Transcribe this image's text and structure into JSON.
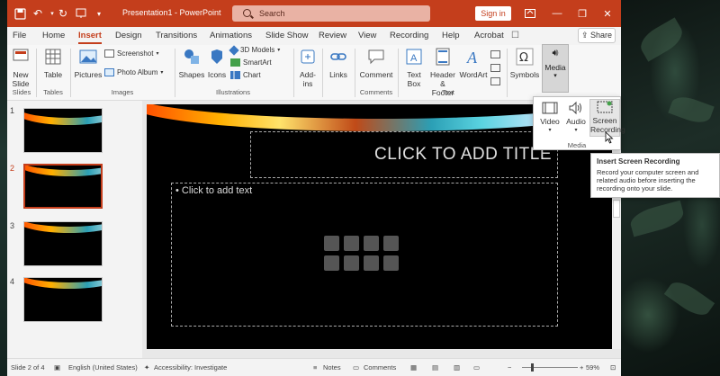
{
  "titlebar": {
    "title": "Presentation1  -  PowerPoint",
    "search_placeholder": "Search",
    "signin_label": "Sign in",
    "minimize": "—",
    "restore": "❐",
    "close": "✕"
  },
  "tabs": [
    {
      "label": "File"
    },
    {
      "label": "Home"
    },
    {
      "label": "Insert",
      "active": true
    },
    {
      "label": "Design"
    },
    {
      "label": "Transitions"
    },
    {
      "label": "Animations"
    },
    {
      "label": "Slide Show"
    },
    {
      "label": "Review"
    },
    {
      "label": "View"
    },
    {
      "label": "Recording"
    },
    {
      "label": "Help"
    },
    {
      "label": "Acrobat"
    }
  ],
  "share_label": "Share",
  "ribbon": {
    "new_slide": "New\nSlide",
    "table": "Table",
    "pictures": "Pictures",
    "screenshot": "Screenshot",
    "photo_album": "Photo Album",
    "shapes": "Shapes",
    "icons": "Icons",
    "models_3d": "3D Models",
    "smartart": "SmartArt",
    "chart": "Chart",
    "addins": "Add-\nins",
    "links": "Links",
    "comment": "Comment",
    "text_box": "Text\nBox",
    "header_footer": "Header\n& Footer",
    "wordart": "WordArt",
    "symbols": "Symbols",
    "media": "Media",
    "groups": {
      "slides": "Slides",
      "tables": "Tables",
      "images": "Images",
      "illustrations": "Illustrations",
      "comments": "Comments",
      "text": "Text",
      "media": "Media"
    }
  },
  "media_panel": {
    "video": "Video",
    "audio": "Audio",
    "screen_recording": "Screen\nRecording",
    "group_label": "Media"
  },
  "tooltip": {
    "title": "Insert Screen Recording",
    "body": "Record your computer screen and related audio before inserting the recording onto your slide."
  },
  "slides": [
    {
      "number": "1"
    },
    {
      "number": "2",
      "active": true
    },
    {
      "number": "3"
    },
    {
      "number": "4"
    }
  ],
  "slide": {
    "title_placeholder": "CLICK TO ADD TITLE",
    "body_placeholder": "• Click to add text"
  },
  "statusbar": {
    "slide_info": "Slide 2 of 4",
    "language": "English (United States)",
    "accessibility": "Accessibility: Investigate",
    "notes": "Notes",
    "comments": "Comments",
    "zoom": "59%"
  },
  "colors": {
    "accent": "#c43e1c",
    "titlebar": "#c43e1c"
  }
}
